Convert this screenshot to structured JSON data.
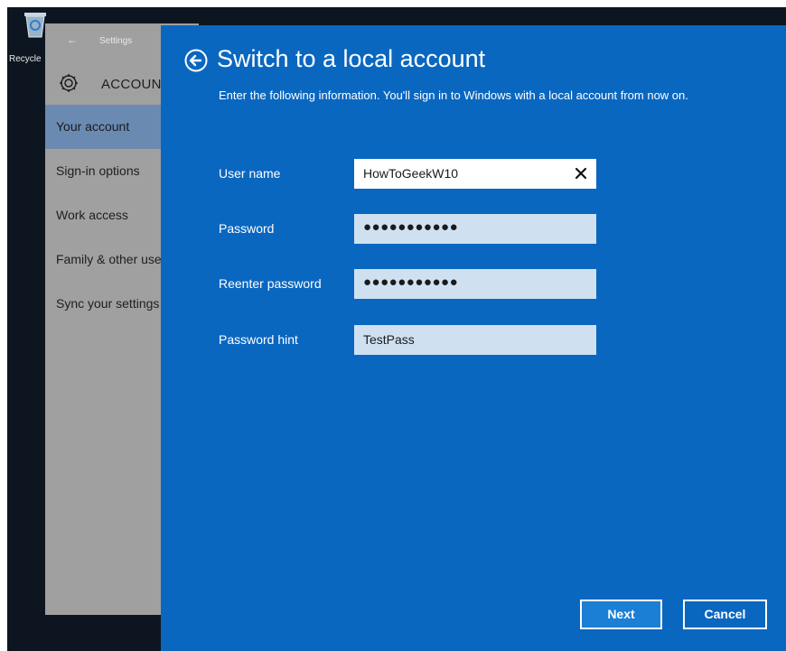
{
  "desktop": {
    "recycle_label": "Recycle"
  },
  "settings_window": {
    "app_title": "Settings",
    "section_title": "ACCOUNTS",
    "nav_items": [
      {
        "label": "Your account"
      },
      {
        "label": "Sign-in options"
      },
      {
        "label": "Work access"
      },
      {
        "label": "Family & other users"
      },
      {
        "label": "Sync your settings"
      }
    ],
    "active_item": "Your account"
  },
  "dialog": {
    "title": "Switch to a local account",
    "description": "Enter the following information. You'll sign in to Windows with a local account from now on.",
    "fields": [
      {
        "label": "User name",
        "value": "HowToGeekW10"
      },
      {
        "label": "Password",
        "value": "●●●●●●●●●●●"
      },
      {
        "label": "Reenter password",
        "value": "●●●●●●●●●●●"
      },
      {
        "label": "Password hint",
        "value": "TestPass"
      }
    ],
    "next_label": "Next",
    "cancel_label": "Cancel"
  },
  "colors": {
    "dialog_background": "#0a67c0",
    "next_button": "#1b7fd6",
    "sidebar_background": "#a0a0a0",
    "active_nav": "#6a8ab2",
    "input_background": "#cfe0f1"
  },
  "icons": {
    "back": "back-arrow-circle-icon",
    "settings": "gear-icon",
    "clear": "close-icon",
    "recycle_bin": "recycle-bin-icon"
  }
}
